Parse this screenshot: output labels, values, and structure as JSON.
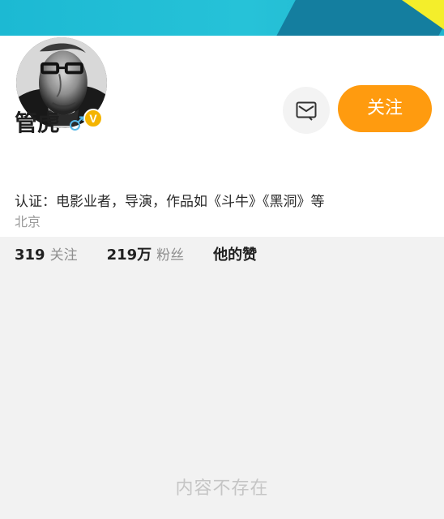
{
  "profile": {
    "name": "管虎",
    "verification": "认证：电影业者，导演，作品如《斗牛》《黑洞》等",
    "location": "北京",
    "icons": {
      "verified": "verified-badge-icon",
      "gender": "male-gender-icon",
      "message": "message-icon"
    }
  },
  "actions": {
    "follow_label": "关注"
  },
  "stats": {
    "following_count": "319",
    "following_label": "关注",
    "followers_count": "219万",
    "followers_label": "粉丝",
    "likes_label": "他的赞"
  },
  "empty_state": {
    "text": "内容不存在"
  },
  "colors": {
    "cover_primary": "#26c2d8",
    "cover_dark": "#147e9f",
    "cover_yellow": "#f4ee2b",
    "follow_button": "#ff9b0f",
    "verified_badge": "#f4b400",
    "gender_icon": "#59b8e6",
    "page_background": "#f2f2f2"
  }
}
